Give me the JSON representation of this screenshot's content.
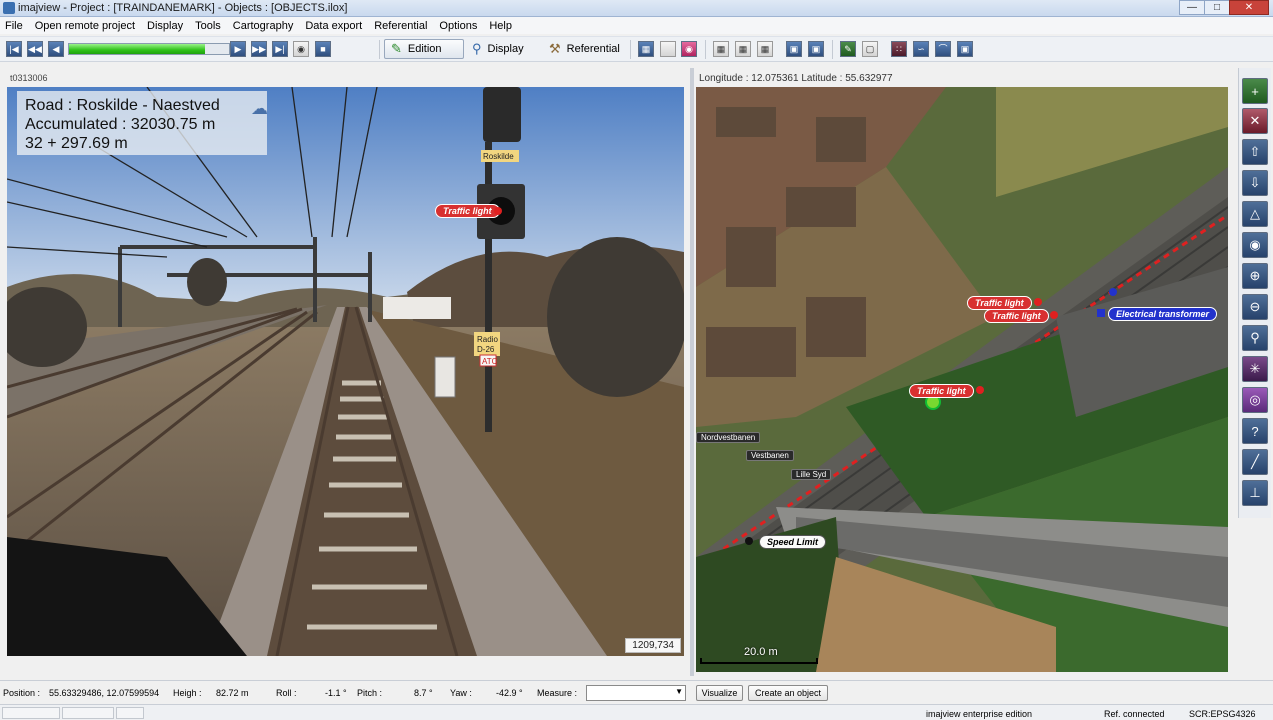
{
  "window": {
    "title": "imajview - Project : [TRAINDANEMARK] - Objects : [OBJECTS.ilox]"
  },
  "menu": [
    "File",
    "Open remote project",
    "Display",
    "Tools",
    "Cartography",
    "Data export",
    "Referential",
    "Options",
    "Help"
  ],
  "toolbar": {
    "progress_fraction": 0.85,
    "modes": {
      "edition": "Edition",
      "display": "Display",
      "referential": "Referential"
    },
    "active_mode": "edition"
  },
  "left": {
    "image_id": "t0313006",
    "overlay": {
      "road": "Road : Roskilde - Naestved",
      "accumulated": "Accumulated : 32030.75 m",
      "chainage": "32 + 297.69 m"
    },
    "signs": {
      "roskilde": "Roskilde",
      "radio": "Radio",
      "d26": "D-26",
      "atc": "ATC"
    },
    "tag": "Traffic light",
    "pixel_readout": "1209,734"
  },
  "right": {
    "lonlat": "Longitude : 12.075361 Latitude : 55.632977",
    "tags": {
      "tl1": "Traffic light",
      "tl2": "Traffic light",
      "tl3": "Traffic light",
      "et": "Electrical transformer",
      "sl": "Speed Limit"
    },
    "lines": {
      "nord": "Nordvestbanen",
      "vest": "Vestbanen",
      "lille": "Lille Syd"
    },
    "scale": "20.0 m"
  },
  "measbar": {
    "position_label": "Position :",
    "position_value": "55.63329486, 12.07599594",
    "heigh_label": "Heigh :",
    "heigh_value": "82.72 m",
    "roll_label": "Roll :",
    "roll_value": "-1.1 °",
    "pitch_label": "Pitch :",
    "pitch_value": "8.7 °",
    "yaw_label": "Yaw :",
    "yaw_value": "-42.9 °",
    "measure_label": "Measure :",
    "measure_value": "",
    "visualize": "Visualize",
    "create": "Create an object"
  },
  "status": {
    "edition": "imajview enterprise edition",
    "ref": "Ref. connected",
    "scr": "SCR:EPSG4326"
  },
  "colors": {
    "tag_red": "#d83030",
    "tag_blue": "#2232cc",
    "rail_red": "#e02020",
    "progress": "#2fc21a"
  }
}
